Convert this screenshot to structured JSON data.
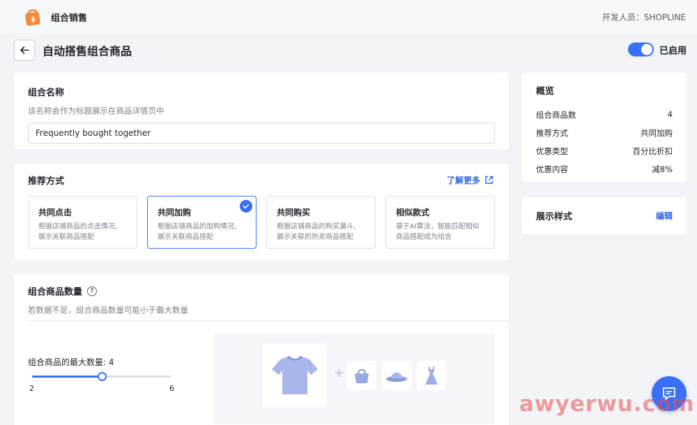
{
  "header": {
    "app_title": "组合销售",
    "developer": "开发人员：SHOPLINE"
  },
  "page": {
    "title": "自动搭售组合商品",
    "toggle_label": "已启用",
    "toggle_on": true
  },
  "name_card": {
    "title": "组合名称",
    "hint": "该名称会作为标题展示在商品详情页中",
    "value": "Frequently bought together"
  },
  "method_card": {
    "title": "推荐方式",
    "learn_more": "了解更多",
    "options": [
      {
        "title": "共同点击",
        "desc1": "根据店铺商品的点击情况,",
        "desc2": "展示关联商品搭配"
      },
      {
        "title": "共同加购",
        "desc1": "根据店铺商品的加购情况,",
        "desc2": "展示关联商品搭配"
      },
      {
        "title": "共同购买",
        "desc1": "根据店铺商品的购买漏斗,",
        "desc2": "展示关联的热卖商品搭配"
      },
      {
        "title": "相似款式",
        "desc1": "基于AI算法，智能匹配相似",
        "desc2": "商品搭配成为组合"
      }
    ],
    "selected_index": 1
  },
  "quantity_card": {
    "title": "组合商品数量",
    "hint": "若数据不足，组合商品数量可能小于最大数量",
    "max_label": "组合商品的最大数量: 4",
    "slider": {
      "min": 2,
      "max": 6,
      "value": 4
    },
    "min_text": "2",
    "max_text": "6"
  },
  "overview": {
    "title": "概览",
    "rows": [
      {
        "label": "组合商品数",
        "value": "4"
      },
      {
        "label": "推荐方式",
        "value": "共同加购"
      },
      {
        "label": "优惠类型",
        "value": "百分比折扣"
      },
      {
        "label": "优惠内容",
        "value": "减8%"
      }
    ]
  },
  "display_style": {
    "title": "展示样式",
    "edit": "编辑"
  },
  "icons": {
    "logo": "shopping-bag-icon",
    "back": "arrow-left-icon",
    "external": "external-link-icon",
    "check": "check-icon",
    "help": "question-circle-icon",
    "chat": "chat-icon"
  },
  "colors": {
    "accent": "#3a6ff7",
    "link": "#2e64e6",
    "logo": "#f28b3c"
  },
  "watermark": "awyerwu.com"
}
